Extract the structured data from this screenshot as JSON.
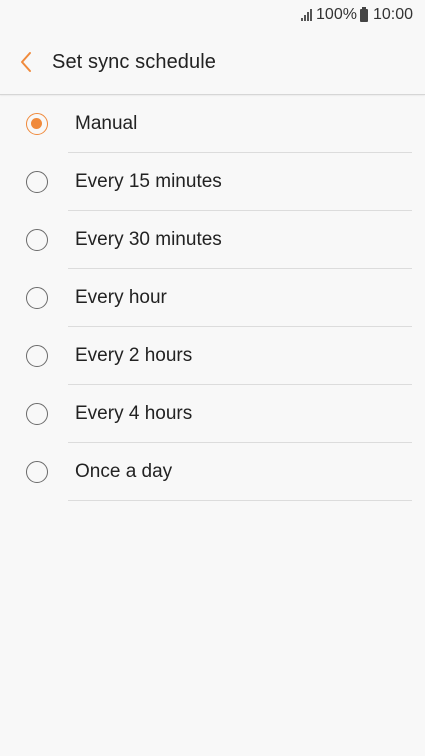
{
  "status_bar": {
    "battery": "100%",
    "time": "10:00"
  },
  "header": {
    "title": "Set sync schedule",
    "back_icon": "chevron-left-icon",
    "accent_color": "#f08a3c"
  },
  "options": [
    {
      "label": "Manual",
      "selected": true
    },
    {
      "label": "Every 15 minutes",
      "selected": false
    },
    {
      "label": "Every 30 minutes",
      "selected": false
    },
    {
      "label": "Every hour",
      "selected": false
    },
    {
      "label": "Every 2 hours",
      "selected": false
    },
    {
      "label": "Every 4 hours",
      "selected": false
    },
    {
      "label": "Once a day",
      "selected": false
    }
  ]
}
